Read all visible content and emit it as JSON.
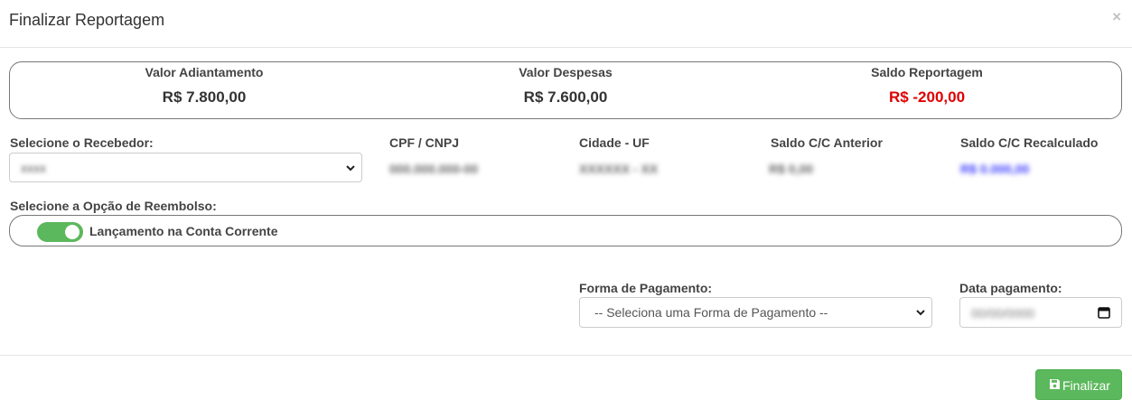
{
  "header": {
    "title": "Finalizar Reportagem",
    "close_label": "×"
  },
  "summary": {
    "advance": {
      "label": "Valor Adiantamento",
      "value": "R$ 7.800,00"
    },
    "expenses": {
      "label": "Valor Despesas",
      "value": "R$ 7.600,00"
    },
    "balance": {
      "label": "Saldo Reportagem",
      "value": "R$ -200,00",
      "color": "#e00000"
    }
  },
  "receiver": {
    "label": "Selecione o Recebedor:",
    "selected": "xxxx",
    "cpf_label": "CPF / CNPJ",
    "cpf_value": "000.000.000-00",
    "city_label": "Cidade - UF",
    "city_value": "XXXXXX - XX",
    "prev_balance_label": "Saldo C/C Anterior",
    "prev_balance_value": "R$ 0,00",
    "recalc_balance_label": "Saldo C/C Recalculado",
    "recalc_balance_value": "R$ 0.000,00"
  },
  "refund": {
    "label": "Selecione a Opção de Reembolso:",
    "option_label": "Lançamento na Conta Corrente",
    "enabled": true
  },
  "payment": {
    "method_label": "Forma de Pagamento:",
    "method_selected": "-- Seleciona uma Forma de Pagamento --",
    "date_label": "Data pagamento:",
    "date_value": "00/00/0000"
  },
  "footer": {
    "finalize_label": "Finalizar"
  },
  "colors": {
    "accent": "#5cb85c",
    "negative": "#e00000",
    "blurred_link": "#3a3aff"
  }
}
